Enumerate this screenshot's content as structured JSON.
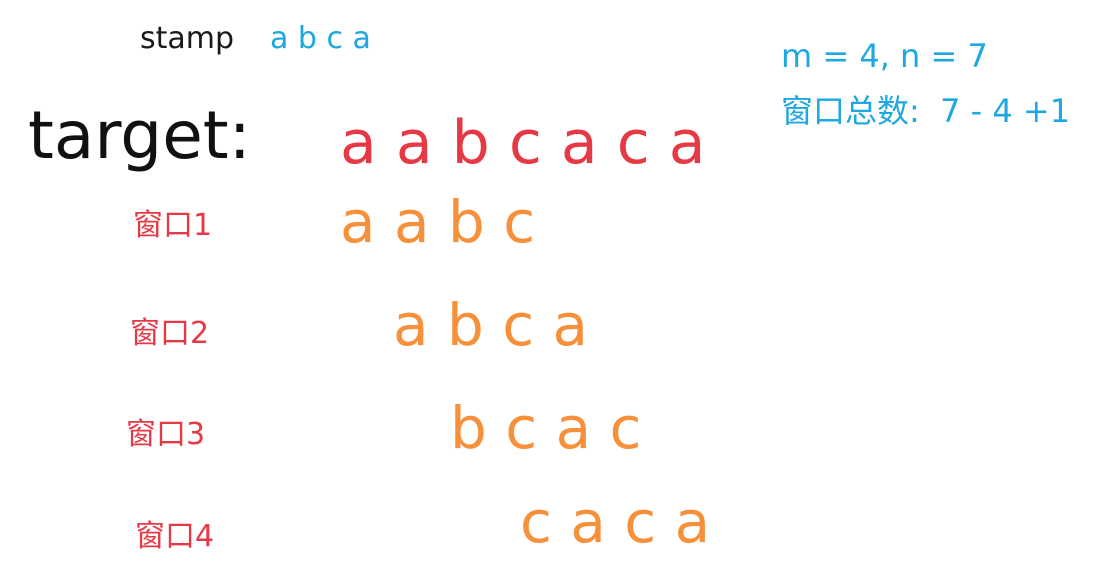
{
  "stamp": {
    "label": "stamp",
    "value": "a b c a"
  },
  "info": {
    "line1": "m = 4, n = 7",
    "line2": "窗口总数:  7 - 4 +1"
  },
  "target": {
    "label": "target:",
    "value": "a a b c a c a"
  },
  "windows": [
    {
      "label": "窗口1",
      "value": "a a b c"
    },
    {
      "label": "窗口2",
      "value": "a b c a"
    },
    {
      "label": "窗口3",
      "value": "b c a c"
    },
    {
      "label": "窗口4",
      "value": "c a c a"
    }
  ],
  "colors": {
    "stamp_value": "#1ea7e0",
    "info": "#1ea7e0",
    "target_value": "#e63946",
    "window_label": "#e63946",
    "window_value": "#f7903b",
    "label_dark": "#111111"
  }
}
